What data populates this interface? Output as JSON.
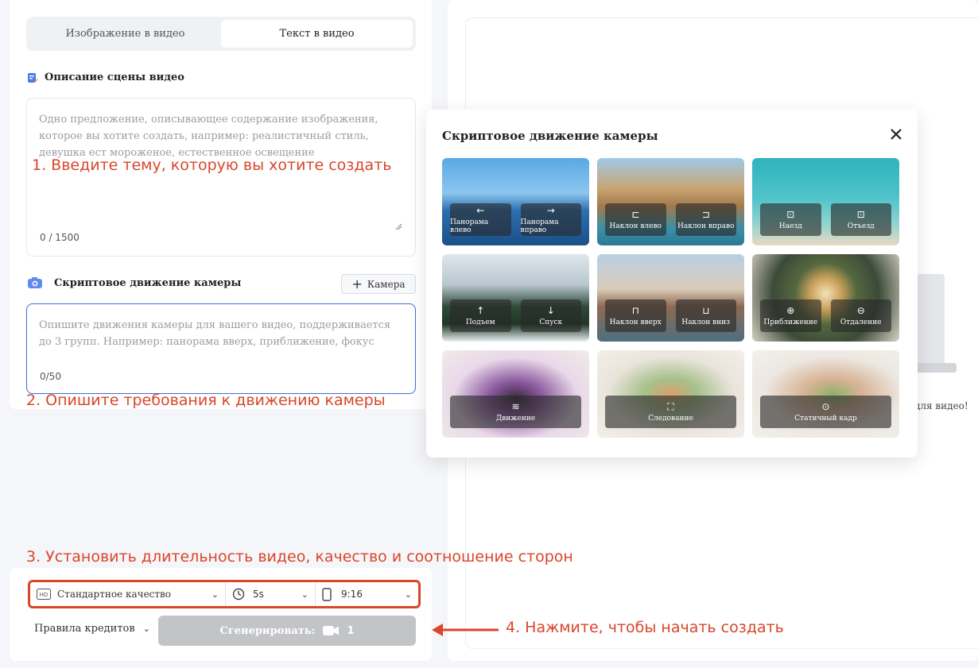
{
  "tabs": [
    {
      "label": "Изображение в видео",
      "active": false
    },
    {
      "label": "Текст в видео",
      "active": true
    }
  ],
  "scene": {
    "title": "Описание сцены видео",
    "placeholder": "Одно предложение, описывающее содержание изображения, которое вы хотите создать, например: реалистичный стиль, девушка ест мороженое, естественное освещение",
    "counter": "0 / 1500"
  },
  "camera": {
    "title": "Скриптовое движение камеры",
    "button_label": "Камера",
    "placeholder": "Опишите движения камеры для вашего видео, поддерживается до 3 групп. Например: панорама вверх, приближение, фокус",
    "counter": "0/50"
  },
  "annotations": {
    "step1": "1. Введите тему, которую вы хотите создать",
    "step2": "2. Опишите требования к движению камеры",
    "step3": "3. Установить длительность видео, качество и соотношение сторон",
    "step4": "4. Нажмите, чтобы начать создать"
  },
  "settings": {
    "quality": "Стандартное качество",
    "duration": "5s",
    "ratio": "9:16"
  },
  "footer": {
    "credits_label": "Правила кредитов",
    "generate_label": "Сгенерировать:",
    "generate_cost": "1"
  },
  "modal": {
    "title": "Скриптовое движение камеры",
    "cards": [
      {
        "buttons": [
          {
            "icon": "arrow-left-icon",
            "glyph": "←",
            "label": "Панорама влево"
          },
          {
            "icon": "arrow-right-icon",
            "glyph": "→",
            "label": "Панорама вправо"
          }
        ]
      },
      {
        "buttons": [
          {
            "icon": "tilt-left-icon",
            "glyph": "⊏",
            "label": "Наклон влево"
          },
          {
            "icon": "tilt-right-icon",
            "glyph": "⊐",
            "label": "Наклон вправо"
          }
        ]
      },
      {
        "buttons": [
          {
            "icon": "zoom-in-frame-icon",
            "glyph": "⊡",
            "label": "Наезд"
          },
          {
            "icon": "zoom-out-frame-icon",
            "glyph": "⊡",
            "label": "Отъезд"
          }
        ]
      },
      {
        "buttons": [
          {
            "icon": "arrow-up-icon",
            "glyph": "↑",
            "label": "Подъем"
          },
          {
            "icon": "arrow-down-icon",
            "glyph": "↓",
            "label": "Спуск"
          }
        ]
      },
      {
        "buttons": [
          {
            "icon": "tilt-up-icon",
            "glyph": "⊓",
            "label": "Наклон вверх"
          },
          {
            "icon": "tilt-down-icon",
            "glyph": "⊔",
            "label": "Наклон вниз"
          }
        ]
      },
      {
        "buttons": [
          {
            "icon": "magnify-plus-icon",
            "glyph": "⊕",
            "label": "Приближение"
          },
          {
            "icon": "magnify-minus-icon",
            "glyph": "⊖",
            "label": "Отдаление"
          }
        ]
      },
      {
        "buttons": [
          {
            "icon": "motion-icon",
            "glyph": "≋",
            "label": "Движение"
          }
        ]
      },
      {
        "buttons": [
          {
            "icon": "follow-frame-icon",
            "glyph": "⛶",
            "label": "Следование"
          }
        ]
      },
      {
        "buttons": [
          {
            "icon": "static-target-icon",
            "glyph": "⊙",
            "label": "Статичный кадр"
          }
        ]
      }
    ]
  },
  "right_hint": "для видео!",
  "colors": {
    "accent_red": "#d9462b",
    "generate_disabled": "#c3c4c7",
    "focus_blue": "#3a6fd8"
  }
}
